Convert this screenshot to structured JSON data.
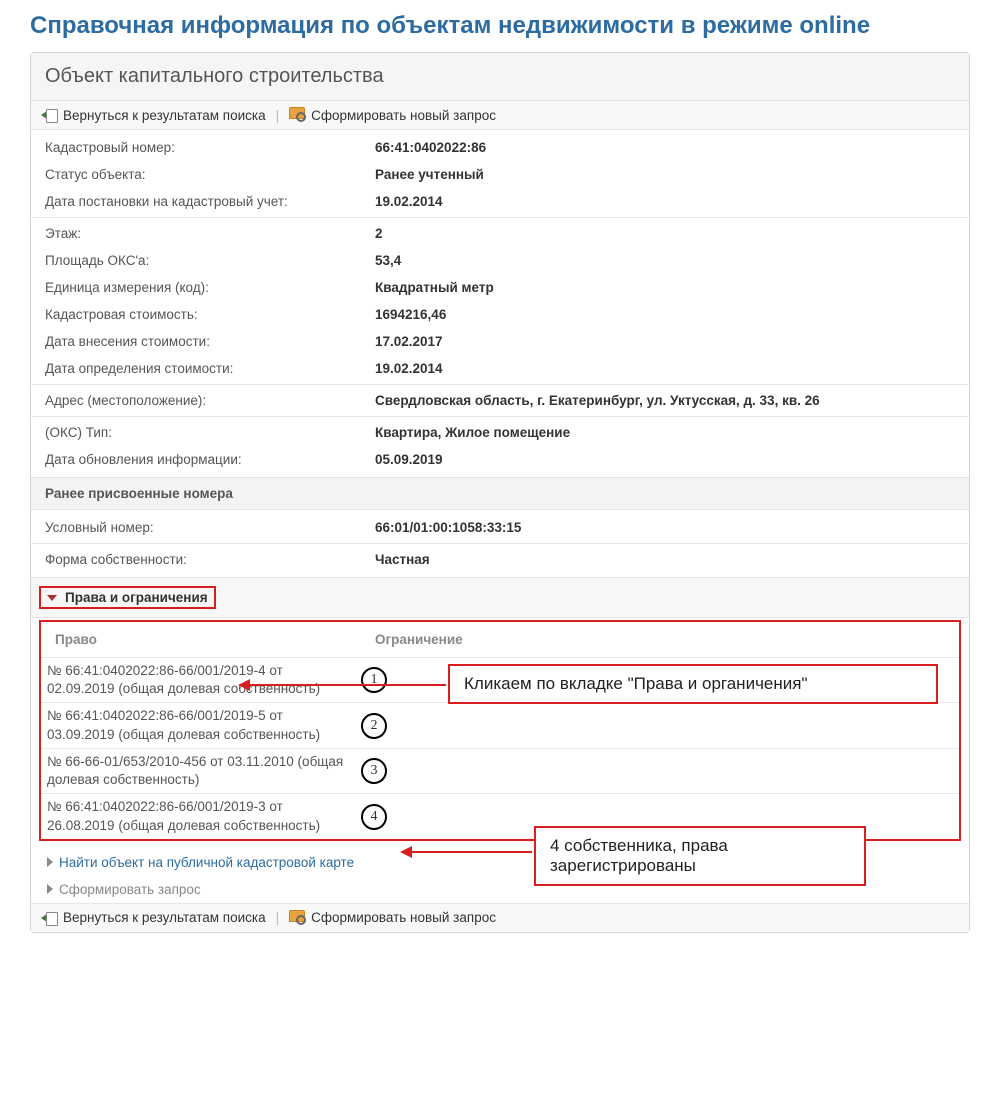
{
  "page_title": "Справочная информация по объектам недвижимости в режиме online",
  "panel_title": "Объект капитального строительства",
  "toolbar": {
    "back_label": "Вернуться к результатам поиска",
    "new_query_label": "Сформировать новый запрос"
  },
  "fields": {
    "cadastral_number_l": "Кадастровый номер:",
    "cadastral_number_v": "66:41:0402022:86",
    "status_l": "Статус объекта:",
    "status_v": "Ранее учтенный",
    "reg_date_l": "Дата постановки на кадастровый учет:",
    "reg_date_v": "19.02.2014",
    "floor_l": "Этаж:",
    "floor_v": "2",
    "area_l": "Площадь ОКС'a:",
    "area_v": "53,4",
    "unit_l": "Единица измерения (код):",
    "unit_v": "Квадратный метр",
    "cad_cost_l": "Кадастровая стоимость:",
    "cad_cost_v": "1694216,46",
    "cost_entry_date_l": "Дата внесения стоимости:",
    "cost_entry_date_v": "17.02.2017",
    "cost_det_date_l": "Дата определения стоимости:",
    "cost_det_date_v": "19.02.2014",
    "address_l": "Адрес (местоположение):",
    "address_v": "Свердловская область, г. Екатеринбург, ул. Уктусская, д. 33, кв. 26",
    "type_l": "(ОКС) Тип:",
    "type_v": "Квартира, Жилое помещение",
    "info_update_l": "Дата обновления информации:",
    "info_update_v": "05.09.2019",
    "prev_numbers_header": "Ранее присвоенные номера",
    "cond_number_l": "Условный номер:",
    "cond_number_v": "66:01/01:00:1058:33:15",
    "own_form_l": "Форма собственности:",
    "own_form_v": "Частная"
  },
  "rights_accordion_title": "Права и ограничения",
  "rights_table": {
    "col1": "Право",
    "col2": "Ограничение"
  },
  "rights": [
    {
      "text": "№ 66:41:0402022:86-66/001/2019-4  от 02.09.2019  (общая долевая собственность)",
      "n": "1"
    },
    {
      "text": "№ 66:41:0402022:86-66/001/2019-5  от 03.09.2019  (общая долевая собственность)",
      "n": "2"
    },
    {
      "text": "№ 66-66-01/653/2010-456  от 03.11.2010  (общая долевая собственность)",
      "n": "3"
    },
    {
      "text": "№ 66:41:0402022:86-66/001/2019-3  от 26.08.2019  (общая долевая собственность)",
      "n": "4"
    }
  ],
  "links": {
    "find_on_map": "Найти объект на публичной кадастровой карте",
    "form_request": "Сформировать запрос"
  },
  "callouts": {
    "c1": "Кликаем по вкладке \"Права и органичения\"",
    "c2": "4 собственника, права зарегистрированы"
  }
}
